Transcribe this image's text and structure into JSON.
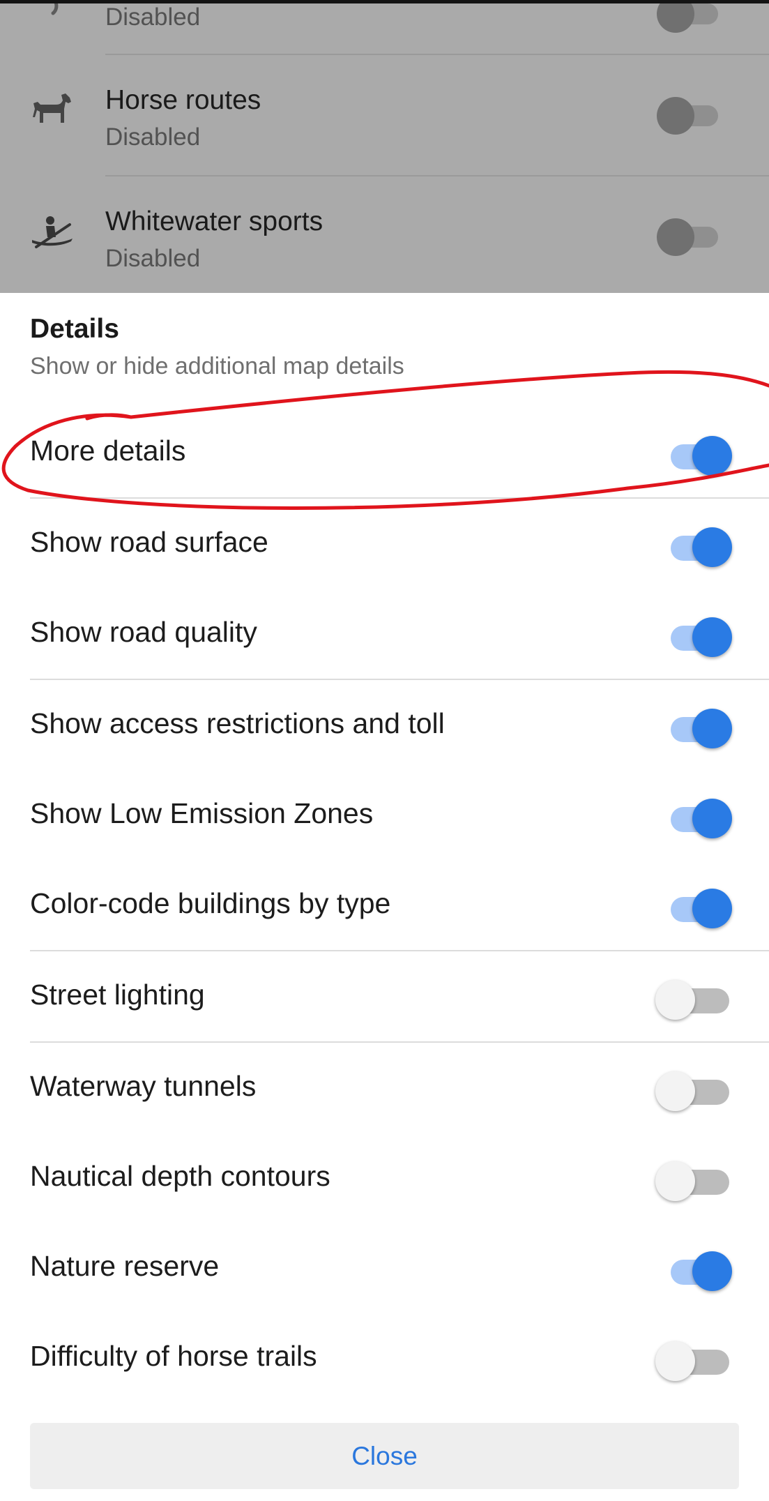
{
  "background_list": {
    "partial_row": {
      "status": "Disabled",
      "icon": "moon-icon",
      "toggle_on": false
    },
    "rows": [
      {
        "title": "Horse routes",
        "status": "Disabled",
        "icon": "horse-icon",
        "toggle_on": false
      },
      {
        "title": "Whitewater sports",
        "status": "Disabled",
        "icon": "kayak-icon",
        "toggle_on": false
      }
    ]
  },
  "sheet": {
    "title": "Details",
    "subtitle": "Show or hide additional map details",
    "items": [
      {
        "label": "More details",
        "on": true
      },
      {
        "label": "Show road surface",
        "on": true
      },
      {
        "label": "Show road quality",
        "on": true
      },
      {
        "label": "Show access restrictions and toll",
        "on": true
      },
      {
        "label": "Show Low Emission Zones",
        "on": true
      },
      {
        "label": "Color-code buildings by type",
        "on": true
      },
      {
        "label": "Street lighting",
        "on": false
      },
      {
        "label": "Waterway tunnels",
        "on": false
      },
      {
        "label": "Nautical depth contours",
        "on": false
      },
      {
        "label": "Nature reserve",
        "on": true
      },
      {
        "label": "Difficulty of horse trails",
        "on": false
      }
    ],
    "close_label": "Close"
  },
  "colors": {
    "accent": "#2a7be4",
    "accent_track": "#a7c8f8",
    "annotation": "#e0141c",
    "dim_overlay": "#aaaaaa"
  }
}
